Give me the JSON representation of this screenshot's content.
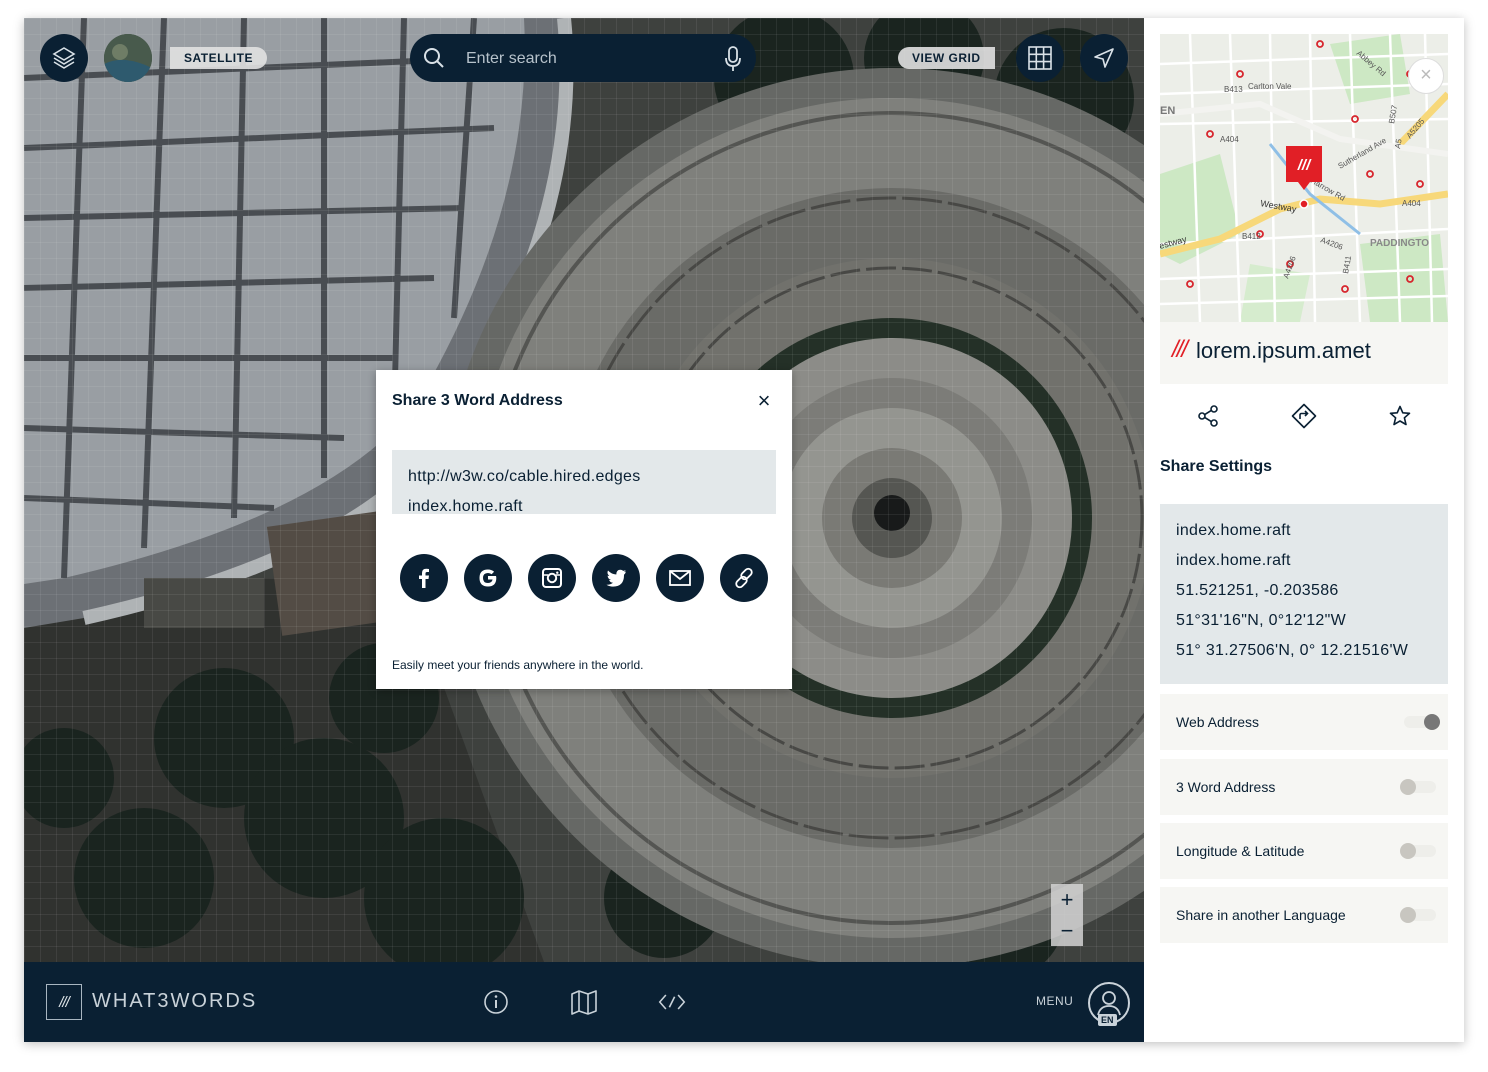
{
  "map": {
    "layer_label": "SATELLITE",
    "search_placeholder": "Enter search",
    "view_grid_label": "VIEW GRID",
    "zoom_in": "+",
    "zoom_out": "−"
  },
  "share_modal": {
    "title": "Share 3 Word Address",
    "close": "×",
    "url_line1": "http://w3w.co/cable.hired.edges",
    "url_line2": "index.home.raft",
    "social": [
      "facebook-icon",
      "google-icon",
      "instagram-icon",
      "twitter-icon",
      "email-icon",
      "link-icon"
    ],
    "footer": "Easily meet your friends anywhere in the world."
  },
  "bottom_bar": {
    "logo_mark": "///",
    "logo_text": "WHAT3WORDS",
    "menu_label": "MENU",
    "language": "EN"
  },
  "panel": {
    "close": "×",
    "address_slashes": "///",
    "address_words": "lorem.ipsum.amet",
    "map_labels": {
      "carlton_vale": "Carlton Vale",
      "en": "EN",
      "westway": "Westway",
      "estway": "estway",
      "paddington": "PADDINGTO",
      "a404": "A404",
      "a404b": "A404",
      "b413": "B413",
      "b412": "B412",
      "a5205": "A5205",
      "a5": "A5",
      "b507": "B507",
      "a4206": "A4206",
      "a4206b": "A4206",
      "b411": "B411",
      "abbey": "Abbey Rd",
      "sutherland": "Sutherland Ave",
      "harrow": "Harrow Rd",
      "pin_mark": "///"
    },
    "settings_title": "Share Settings",
    "info_lines": [
      "index.home.raft",
      "index.home.raft",
      "51.521251, -0.203586",
      "51°31'16\"N, 0°12'12\"W",
      "51° 31.27506'N, 0° 12.21516'W"
    ],
    "options": [
      {
        "label": "Web Address",
        "on": true
      },
      {
        "label": "3 Word Address",
        "on": false
      },
      {
        "label": "Longitude & Latitude",
        "on": false
      },
      {
        "label": "Share in another Language",
        "on": false
      }
    ]
  },
  "colors": {
    "navy": "#0a2033",
    "red": "#e11f26",
    "panel_bg": "#f6f6f3",
    "info_bg": "#e3e8ea"
  }
}
